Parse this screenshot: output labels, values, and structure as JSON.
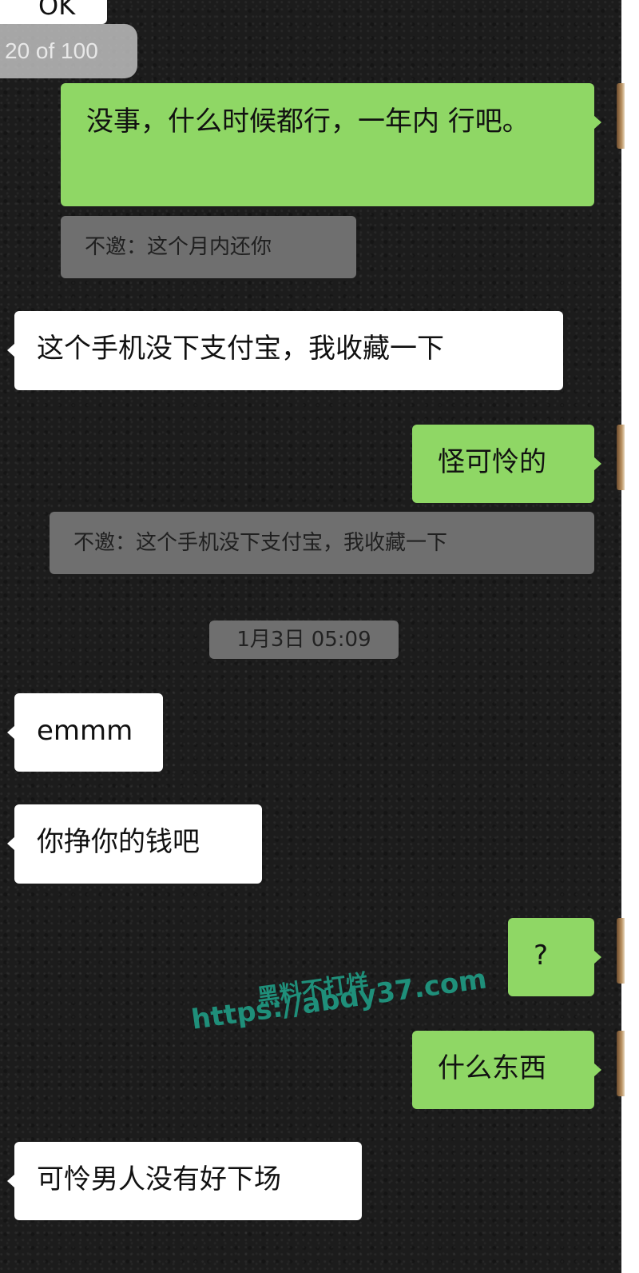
{
  "top_fragment": {
    "text": "OK"
  },
  "page_counter": {
    "text": "20 of 100"
  },
  "messages": [
    {
      "id": 1,
      "text": "没事，什么时候都行，一年内 行吧。"
    },
    {
      "id": 2,
      "text": "不邀：这个月内还你"
    },
    {
      "id": 3,
      "text": "这个手机没下支付宝，我收藏一下"
    },
    {
      "id": 4,
      "text": "怪可怜的"
    },
    {
      "id": 5,
      "text": "不邀：这个手机没下支付宝，我收藏一下"
    },
    {
      "id": 6,
      "text": "1月3日 05:09"
    },
    {
      "id": 7,
      "text": "emmm"
    },
    {
      "id": 8,
      "text": "你挣你的钱吧"
    },
    {
      "id": 9,
      "text": "?"
    },
    {
      "id": 10,
      "text": "什么东西"
    },
    {
      "id": 11,
      "text": "可怜男人没有好下场"
    }
  ],
  "watermark": {
    "line1": "黑料不打烊",
    "line2": "https://abdy37.com",
    "color": "#1f8f7a"
  },
  "colors": {
    "sent_bubble": "#8fd765",
    "received_bubble": "#ffffff",
    "quote_bubble": "#6f6f6f",
    "background": "#1c1c1c"
  }
}
